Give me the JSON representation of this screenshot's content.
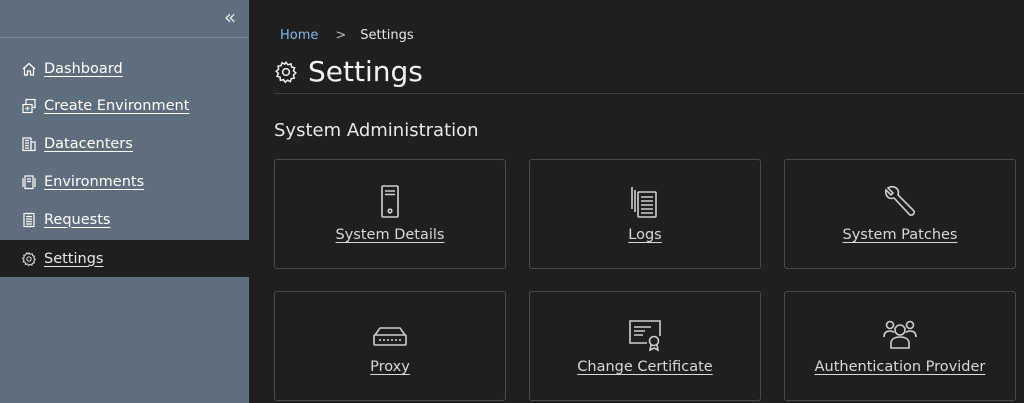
{
  "sidebar": {
    "collapse_glyph": "«",
    "items": [
      {
        "label": "Dashboard",
        "icon": "home-icon"
      },
      {
        "label": "Create Environment",
        "icon": "copy-icon"
      },
      {
        "label": "Datacenters",
        "icon": "building-icon"
      },
      {
        "label": "Environments",
        "icon": "storage-icon"
      },
      {
        "label": "Requests",
        "icon": "list-icon"
      },
      {
        "label": "Settings",
        "icon": "gear-icon",
        "active": true
      }
    ]
  },
  "breadcrumb": {
    "home": "Home",
    "separator": ">",
    "current": "Settings"
  },
  "page": {
    "title": "Settings",
    "section_title": "System Administration"
  },
  "cards": [
    {
      "label": "System Details",
      "icon": "server-icon"
    },
    {
      "label": "Logs",
      "icon": "logs-icon"
    },
    {
      "label": "System Patches",
      "icon": "wrench-icon"
    },
    {
      "label": "Proxy",
      "icon": "network-device-icon"
    },
    {
      "label": "Change Certificate",
      "icon": "certificate-icon"
    },
    {
      "label": "Authentication Provider",
      "icon": "users-icon"
    }
  ],
  "colors": {
    "sidebar_bg": "#5e6e7c",
    "main_bg": "#1f1f1f",
    "link": "#7fb9e6",
    "card_border": "#4a4a4a"
  }
}
